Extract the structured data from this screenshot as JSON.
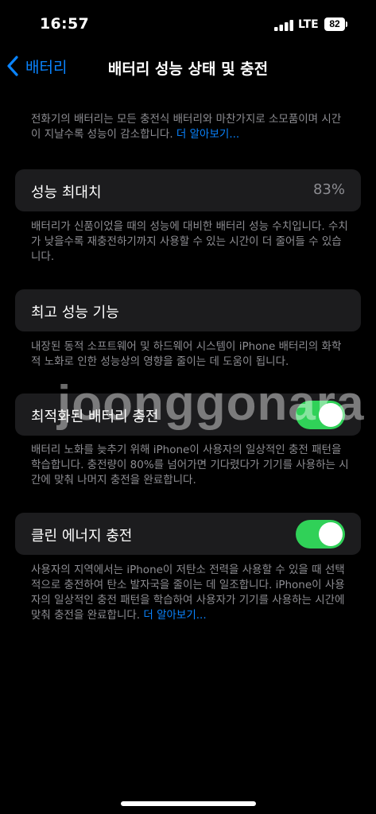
{
  "status_bar": {
    "time": "16:57",
    "network": "LTE",
    "battery_level": "82"
  },
  "nav": {
    "back_label": "배터리",
    "title": "배터리 성능 상태 및 충전"
  },
  "intro": {
    "text": "전화기의 배터리는 모든 충전식 배터리와 마찬가지로 소모품이며 시간이 지날수록 성능이 감소합니다. ",
    "link": "더 알아보기..."
  },
  "max_capacity": {
    "label": "성능 최대치",
    "value": "83%",
    "footnote": "배터리가 신품이었을 때의 성능에 대비한 배터리 성능 수치입니다. 수치가 낮을수록 재충전하기까지 사용할 수 있는 시간이 더 줄어들 수 있습니다."
  },
  "peak_performance": {
    "label": "최고 성능 기능",
    "footnote": "내장된 동적 소프트웨어 및 하드웨어 시스템이 iPhone 배터리의 화학적 노화로 인한 성능상의 영향을 줄이는 데 도움이 됩니다."
  },
  "optimized_charging": {
    "label": "최적화된 배터리 충전",
    "enabled": true,
    "footnote": "배터리 노화를 늦추기 위해 iPhone이 사용자의 일상적인 충전 패턴을 학습합니다. 충전량이 80%를 넘어가면 기다렸다가 기기를 사용하는 시간에 맞춰 나머지 충전을 완료합니다."
  },
  "clean_energy": {
    "label": "클린 에너지 충전",
    "enabled": true,
    "footnote": "사용자의 지역에서는 iPhone이 저탄소 전력을 사용할 수 있을 때 선택적으로 충전하여 탄소 발자국을 줄이는 데 일조합니다. iPhone이 사용자의 일상적인 충전 패턴을 학습하여 사용자가 기기를 사용하는 시간에 맞춰 충전을 완료합니다. ",
    "link": "더 알아보기..."
  },
  "watermark": "joonggonara",
  "colors": {
    "accent": "#0a84ff",
    "toggle_on": "#30d158",
    "cell_background": "#1c1c1e",
    "secondary_text": "#8d8d92"
  }
}
